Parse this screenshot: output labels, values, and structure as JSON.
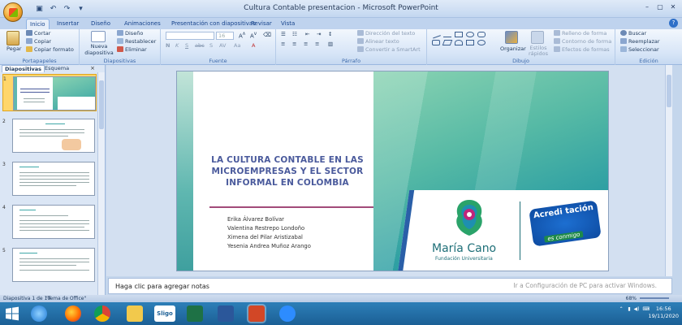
{
  "window": {
    "title": "Cultura Contable presentacion - Microsoft PowerPoint"
  },
  "tabs": [
    "Inicio",
    "Insertar",
    "Diseño",
    "Animaciones",
    "Presentación con diapositivas",
    "Revisar",
    "Vista"
  ],
  "ribbon": {
    "portapapeles": {
      "label": "Portapapeles",
      "paste": "Pegar",
      "cut": "Cortar",
      "copy": "Copiar",
      "format_painter": "Copiar formato"
    },
    "diapositivas": {
      "label": "Diapositivas",
      "new_slide": "Nueva diapositiva",
      "layout": "Diseño",
      "reset": "Restablecer",
      "delete": "Eliminar"
    },
    "fuente": {
      "label": "Fuente",
      "font_size": "16"
    },
    "parrafo": {
      "label": "Párrafo",
      "text_direction": "Dirección del texto",
      "align_text": "Alinear texto",
      "smartart": "Convertir a SmartArt"
    },
    "dibujo": {
      "label": "Dibujo",
      "arrange": "Organizar",
      "quick_styles": "Estilos rápidos",
      "fill": "Relleno de forma",
      "outline": "Contorno de forma",
      "effects": "Efectos de formas"
    },
    "edicion": {
      "label": "Edición",
      "find": "Buscar",
      "replace": "Reemplazar",
      "select": "Seleccionar"
    }
  },
  "left_panel": {
    "tabs": [
      "Diapositivas",
      "Esquema"
    ],
    "close": "×",
    "slide_numbers": [
      "1",
      "2",
      "3",
      "4",
      "5"
    ]
  },
  "slide": {
    "title": "LA CULTURA CONTABLE EN LAS MICROEMPRESAS Y EL SECTOR INFORMAL EN COLOMBIA",
    "authors": [
      "Erika Álvarez Bolívar",
      "Valentina Restrepo Londoño",
      "Ximena del Pilar Aristizabal",
      "Yesenia Andrea Muñoz Arango"
    ],
    "logo_name": "María Cano",
    "logo_sub": "Fundación Universitaria",
    "badge_text": "Acredi tación",
    "badge_tag": "es conmigo"
  },
  "notes": {
    "placeholder": "Haga clic para agregar notas",
    "activation_watermark": "Ir a Configuración de PC para activar Windows."
  },
  "status": {
    "slide_count": "Diapositiva 1 de 10",
    "theme": "\"Tema de Office\"",
    "zoom": "68%"
  },
  "taskbar": {
    "search_label": "Sligo",
    "time": "16:56",
    "date": "19/11/2020"
  },
  "colors": {
    "title_color": "#4a5a9c",
    "accent_teal": "#2fa0a3",
    "rule_color": "#a24a7a",
    "taskbar": "#1b5f95"
  }
}
